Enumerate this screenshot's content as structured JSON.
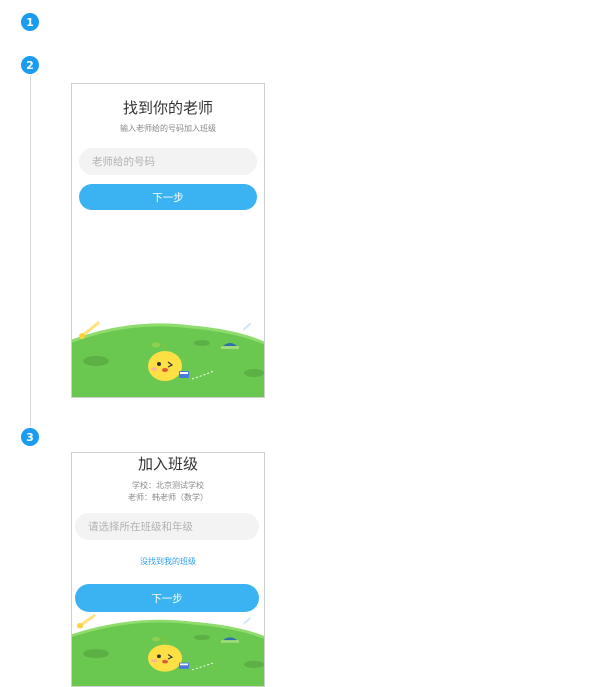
{
  "steps": [
    "1",
    "2",
    "3"
  ],
  "screen2": {
    "title": "找到你的老师",
    "subtitle": "输入老师给的号码加入班级",
    "input_placeholder": "老师给的号码",
    "next_label": "下一步"
  },
  "screen3": {
    "title": "加入班级",
    "school_line": "学校：北京测试学校",
    "teacher_line": "老师：韩老师（数学）",
    "select_placeholder": "请选择所在班级和年级",
    "not_found_link": "没找到我的班级",
    "next_label": "下一步"
  },
  "colors": {
    "step_badge": "#1a9cf0",
    "button": "#3bb3f3",
    "link": "#2e9fe6",
    "grass": "#6ac850",
    "input_bg": "#f3f3f3"
  },
  "icons": [
    "star-icon",
    "mascot-chick-icon",
    "cap-icon",
    "book-icon"
  ]
}
